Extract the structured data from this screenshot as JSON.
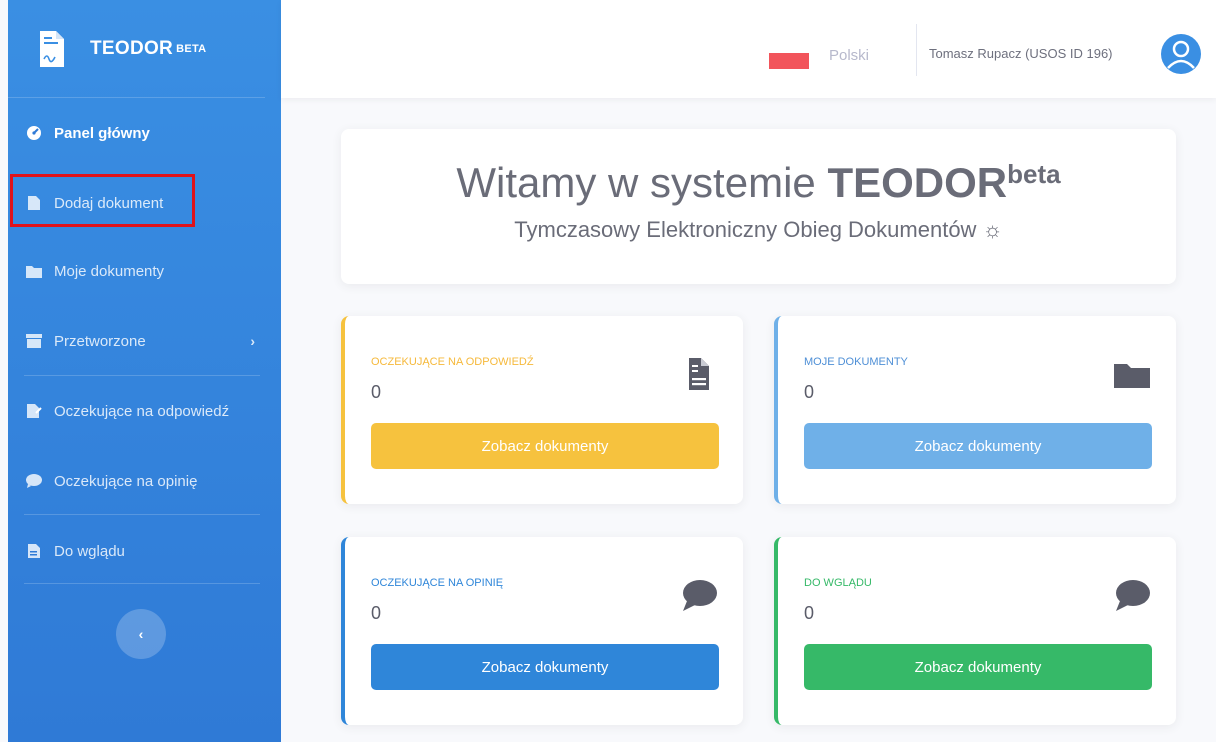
{
  "brand": {
    "name": "TEODOR",
    "badge": "BETA"
  },
  "sidebar": {
    "items": [
      {
        "label": "Panel główny",
        "icon": "gauge-icon"
      },
      {
        "label": "Dodaj dokument",
        "icon": "file-icon"
      },
      {
        "label": "Moje dokumenty",
        "icon": "folder-icon"
      },
      {
        "label": "Przetworzone",
        "icon": "archive-icon"
      },
      {
        "label": "Oczekujące na odpowiedź",
        "icon": "file-signature-icon"
      },
      {
        "label": "Oczekujące na opinię",
        "icon": "comment-icon"
      },
      {
        "label": "Do wglądu",
        "icon": "file-alt-icon"
      }
    ],
    "collapse_label": "‹"
  },
  "topbar": {
    "language": "Polski",
    "user": "Tomasz Rupacz (USOS ID 196)"
  },
  "welcome": {
    "title_prefix": "Witamy w systemie",
    "title_brand": "TEODOR",
    "title_sup": "beta",
    "subtitle": "Tymczasowy Elektroniczny Obieg Dokumentów ☼"
  },
  "cards": [
    {
      "title": "OCZEKUJĄCE NA ODPOWIEDŹ",
      "count": "0",
      "button": "Zobacz dokumenty",
      "color": "#f6c23e",
      "icon": "file-signature-icon"
    },
    {
      "title": "MOJE DOKUMENTY",
      "count": "0",
      "button": "Zobacz dokumenty",
      "color": "#6fb0e8",
      "icon": "folder-icon"
    },
    {
      "title": "OCZEKUJĄCE NA OPINIĘ",
      "count": "0",
      "button": "Zobacz dokumenty",
      "color": "#2f86d9",
      "icon": "comment-icon"
    },
    {
      "title": "DO WGLĄDU",
      "count": "0",
      "button": "Zobacz dokumenty",
      "color": "#36b968",
      "icon": "comment-icon"
    }
  ]
}
